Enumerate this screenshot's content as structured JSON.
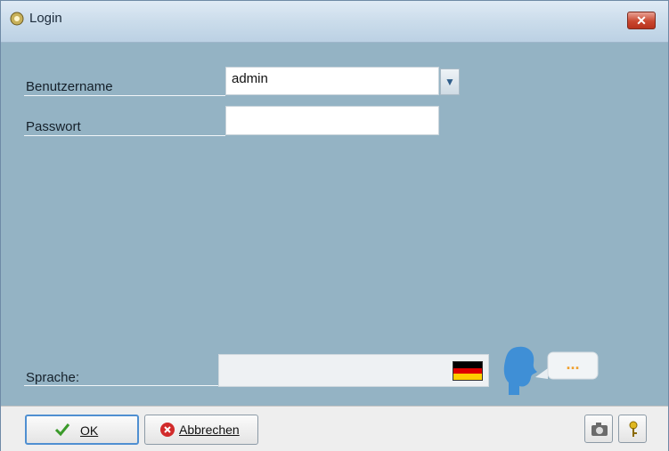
{
  "window": {
    "title": "Login",
    "close_symbol": "✕"
  },
  "form": {
    "username_label": "Benutzername",
    "username_value": "admin",
    "password_label": "Passwort",
    "password_value": "",
    "language_label": "Sprache:",
    "language_value": "",
    "speech_bubble_text": "..."
  },
  "footer": {
    "ok_label": "OK",
    "cancel_label": "Abbrechen"
  },
  "icons": {
    "title": "lock-icon",
    "dropdown": "chevron-down-icon",
    "flag": "german-flag-icon",
    "speaker": "speaking-head-icon",
    "ok": "checkmark-icon",
    "cancel": "cancel-icon",
    "camera": "camera-icon",
    "help": "key-icon"
  },
  "colors": {
    "content_bg": "#94b3c4",
    "ok_border": "#4f8fd1",
    "flag_black": "#000000",
    "flag_red": "#dd0000",
    "flag_gold": "#ffce00"
  }
}
